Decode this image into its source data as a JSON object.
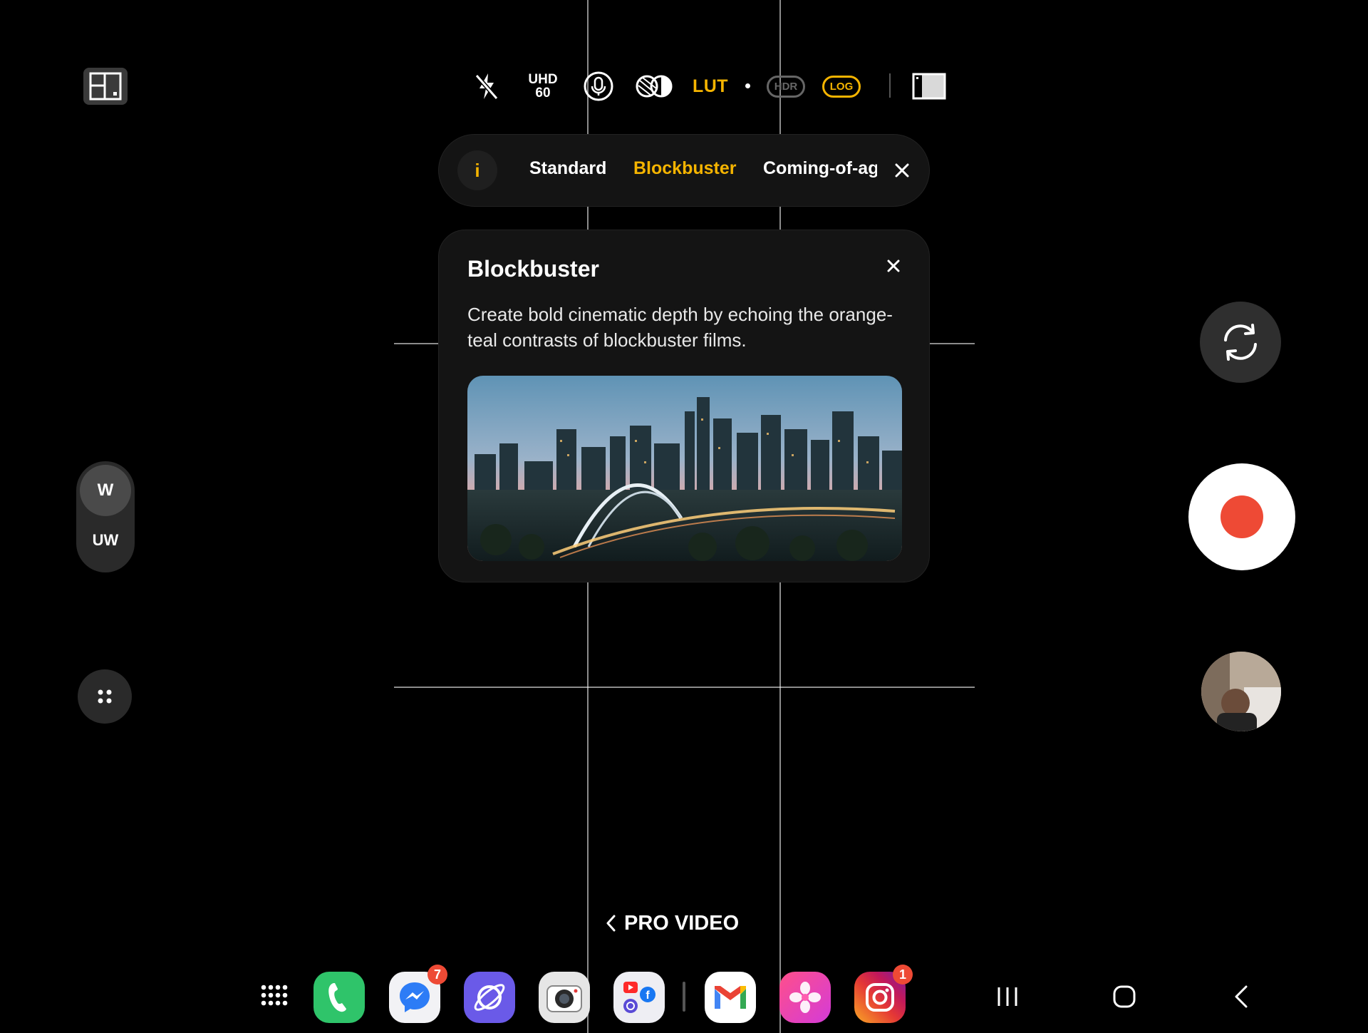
{
  "top_bar": {
    "uhd_label": "UHD",
    "fps_label": "60",
    "lut_label": "LUT",
    "hdr_label": "HDR",
    "log_label": "LOG",
    "icons": [
      "layout-icon",
      "flash-off-icon",
      "mic-icon",
      "filter-icon",
      "aspect-ratio-icon"
    ]
  },
  "lut_selector": {
    "info_label": "i",
    "options": [
      "Standard",
      "Blockbuster",
      "Coming-of-age"
    ],
    "selected": "Blockbuster"
  },
  "info_card": {
    "title": "Blockbuster",
    "description": "Create bold cinematic depth by echoing the orange-teal contrasts of blockbuster films."
  },
  "zoom": {
    "wide_label": "W",
    "ultrawide_label": "UW",
    "selected": "W"
  },
  "mode": {
    "label": "PRO VIDEO"
  },
  "taskbar": {
    "apps": [
      {
        "name": "Phone"
      },
      {
        "name": "Messenger",
        "badge": "7"
      },
      {
        "name": "Internet"
      },
      {
        "name": "Camera"
      },
      {
        "name": "Social folder"
      },
      {
        "name": "Gmail"
      },
      {
        "name": "Gallery"
      },
      {
        "name": "Instagram",
        "badge": "1"
      }
    ]
  },
  "colors": {
    "accent": "#f5b400",
    "record": "#ee4a35",
    "panel": "#141414"
  }
}
